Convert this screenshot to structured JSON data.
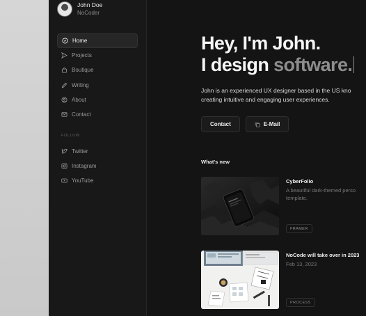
{
  "profile": {
    "name": "John Doe",
    "role": "NoCoder"
  },
  "nav": [
    {
      "label": "Home",
      "icon": "compass-icon",
      "active": true
    },
    {
      "label": "Projects",
      "icon": "send-icon"
    },
    {
      "label": "Boutique",
      "icon": "bag-icon"
    },
    {
      "label": "Writing",
      "icon": "pen-icon"
    },
    {
      "label": "About",
      "icon": "user-icon"
    },
    {
      "label": "Contact",
      "icon": "mail-icon"
    }
  ],
  "follow_label": "FOLLOW",
  "social": [
    {
      "label": "Twitter",
      "icon": "twitter-icon"
    },
    {
      "label": "Instagram",
      "icon": "instagram-icon"
    },
    {
      "label": "YouTube",
      "icon": "youtube-icon"
    }
  ],
  "hero": {
    "line1": "Hey, I'm John.",
    "line2_prefix": "I design ",
    "line2_accent": "software."
  },
  "intro": {
    "line1": "John is an experienced UX designer based in the US kno",
    "line2": "creating intuitive and engaging user experiences."
  },
  "buttons": {
    "contact": "Contact",
    "email": "E-Mail"
  },
  "whats_new": "What's new",
  "posts": [
    {
      "title": "CyberFolio",
      "desc_line1": "A beautiful dark-themed perso",
      "desc_line2": "template.",
      "tag": "FRAMER"
    },
    {
      "title": "NoCode will take over in 2023",
      "desc_line1": "Feb 13, 2023",
      "desc_line2": "",
      "tag": "PROCESS"
    }
  ],
  "colors": {
    "background": "#141414",
    "sidebar": "#181818",
    "accent_text": "#8d8d8d"
  }
}
